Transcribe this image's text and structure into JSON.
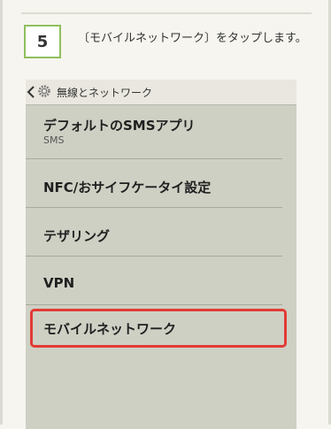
{
  "step": {
    "number": "5",
    "instruction": "〔モバイルネットワーク〕をタップします。"
  },
  "screen": {
    "header_title": "無線とネットワーク",
    "items": [
      {
        "label": "デフォルトのSMSアプリ",
        "sub": "SMS"
      },
      {
        "label": "NFC/おサイフケータイ設定"
      },
      {
        "label": "テザリング"
      },
      {
        "label": "VPN"
      },
      {
        "label": "モバイルネットワーク"
      }
    ]
  },
  "colors": {
    "step_border": "#8fbf5e",
    "highlight": "#e23b35",
    "screen_bg": "#cfd0c4"
  }
}
